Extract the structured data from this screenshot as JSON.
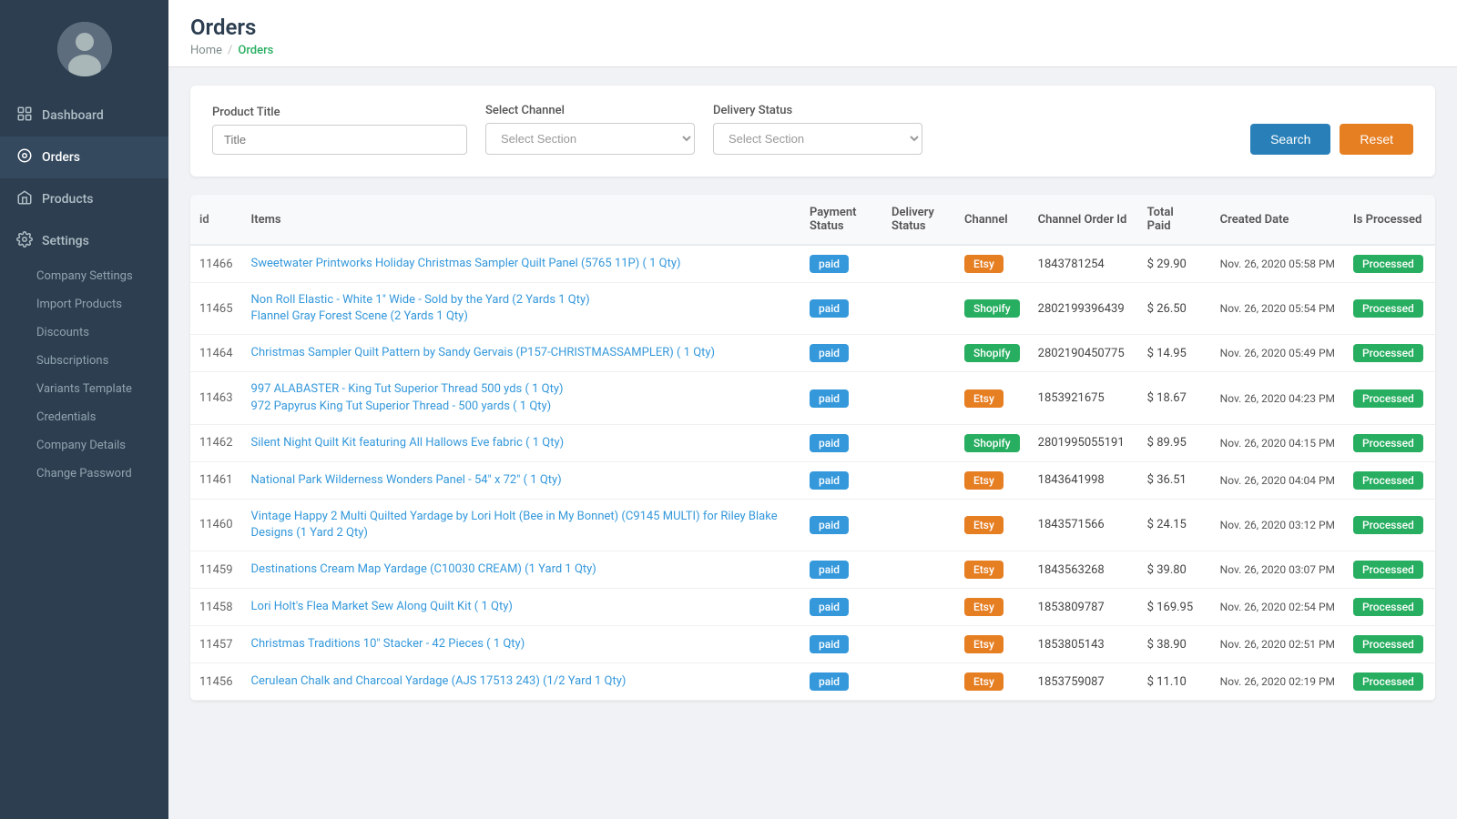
{
  "sidebar": {
    "nav_items": [
      {
        "id": "dashboard",
        "label": "Dashboard",
        "icon": "dashboard-icon",
        "active": false
      },
      {
        "id": "orders",
        "label": "Orders",
        "icon": "orders-icon",
        "active": true
      },
      {
        "id": "products",
        "label": "Products",
        "icon": "products-icon",
        "active": false
      },
      {
        "id": "settings",
        "label": "Settings",
        "icon": "settings-icon",
        "active": false,
        "expanded": true
      }
    ],
    "settings_submenu": [
      {
        "id": "company-settings",
        "label": "Company Settings"
      },
      {
        "id": "import-products",
        "label": "Import Products"
      },
      {
        "id": "discounts",
        "label": "Discounts"
      },
      {
        "id": "subscriptions",
        "label": "Subscriptions"
      },
      {
        "id": "variants-template",
        "label": "Variants Template"
      },
      {
        "id": "credentials",
        "label": "Credentials"
      },
      {
        "id": "company-details",
        "label": "Company Details"
      },
      {
        "id": "change-password",
        "label": "Change Password"
      }
    ]
  },
  "page": {
    "title": "Orders",
    "breadcrumb_home": "Home",
    "breadcrumb_separator": "/",
    "breadcrumb_current": "Orders"
  },
  "filters": {
    "product_title_label": "Product Title",
    "product_title_placeholder": "Title",
    "select_channel_label": "Select Channel",
    "select_channel_placeholder": "Select Section",
    "delivery_status_label": "Delivery Status",
    "delivery_status_placeholder": "Select Section",
    "search_button": "Search",
    "reset_button": "Reset"
  },
  "table": {
    "columns": [
      "id",
      "Items",
      "Payment Status",
      "Delivery Status",
      "Channel",
      "Channel Order Id",
      "Total Paid",
      "Created Date",
      "Is Processed"
    ],
    "rows": [
      {
        "id": "11466",
        "items": [
          "Sweetwater Printworks Holiday Christmas Sampler Quilt Panel (5765 11P) ( 1 Qty)"
        ],
        "payment_status": "paid",
        "delivery_status": "",
        "channel": "Etsy",
        "channel_order_id": "1843781254",
        "total_paid": "$ 29.90",
        "created_date": "Nov. 26, 2020 05:58 PM",
        "is_processed": "Processed"
      },
      {
        "id": "11465",
        "items": [
          "Non Roll Elastic - White 1\" Wide - Sold by the Yard (2 Yards 1 Qty)",
          "Flannel Gray Forest Scene (2 Yards 1 Qty)"
        ],
        "payment_status": "paid",
        "delivery_status": "",
        "channel": "Shopify",
        "channel_order_id": "2802199396439",
        "total_paid": "$ 26.50",
        "created_date": "Nov. 26, 2020 05:54 PM",
        "is_processed": "Processed"
      },
      {
        "id": "11464",
        "items": [
          "Christmas Sampler Quilt Pattern by Sandy Gervais (P157-CHRISTMASSAMPLER) ( 1 Qty)"
        ],
        "payment_status": "paid",
        "delivery_status": "",
        "channel": "Shopify",
        "channel_order_id": "2802190450775",
        "total_paid": "$ 14.95",
        "created_date": "Nov. 26, 2020 05:49 PM",
        "is_processed": "Processed"
      },
      {
        "id": "11463",
        "items": [
          "997 ALABASTER - King Tut Superior Thread 500 yds ( 1 Qty)",
          "972 Papyrus King Tut Superior Thread - 500 yards ( 1 Qty)"
        ],
        "payment_status": "paid",
        "delivery_status": "",
        "channel": "Etsy",
        "channel_order_id": "1853921675",
        "total_paid": "$ 18.67",
        "created_date": "Nov. 26, 2020 04:23 PM",
        "is_processed": "Processed"
      },
      {
        "id": "11462",
        "items": [
          "Silent Night Quilt Kit featuring All Hallows Eve fabric ( 1 Qty)"
        ],
        "payment_status": "paid",
        "delivery_status": "",
        "channel": "Shopify",
        "channel_order_id": "2801995055191",
        "total_paid": "$ 89.95",
        "created_date": "Nov. 26, 2020 04:15 PM",
        "is_processed": "Processed"
      },
      {
        "id": "11461",
        "items": [
          "National Park Wilderness Wonders Panel - 54\" x 72\" ( 1 Qty)"
        ],
        "payment_status": "paid",
        "delivery_status": "",
        "channel": "Etsy",
        "channel_order_id": "1843641998",
        "total_paid": "$ 36.51",
        "created_date": "Nov. 26, 2020 04:04 PM",
        "is_processed": "Processed"
      },
      {
        "id": "11460",
        "items": [
          "Vintage Happy 2 Multi Quilted Yardage by Lori Holt (Bee in My Bonnet) (C9145 MULTI) for Riley Blake Designs (1 Yard 2 Qty)"
        ],
        "payment_status": "paid",
        "delivery_status": "",
        "channel": "Etsy",
        "channel_order_id": "1843571566",
        "total_paid": "$ 24.15",
        "created_date": "Nov. 26, 2020 03:12 PM",
        "is_processed": "Processed"
      },
      {
        "id": "11459",
        "items": [
          "Destinations Cream Map Yardage (C10030 CREAM) (1 Yard 1 Qty)"
        ],
        "payment_status": "paid",
        "delivery_status": "",
        "channel": "Etsy",
        "channel_order_id": "1843563268",
        "total_paid": "$ 39.80",
        "created_date": "Nov. 26, 2020 03:07 PM",
        "is_processed": "Processed"
      },
      {
        "id": "11458",
        "items": [
          "Lori Holt's Flea Market Sew Along Quilt Kit ( 1 Qty)"
        ],
        "payment_status": "paid",
        "delivery_status": "",
        "channel": "Etsy",
        "channel_order_id": "1853809787",
        "total_paid": "$ 169.95",
        "created_date": "Nov. 26, 2020 02:54 PM",
        "is_processed": "Processed"
      },
      {
        "id": "11457",
        "items": [
          "Christmas Traditions 10\" Stacker - 42 Pieces ( 1 Qty)"
        ],
        "payment_status": "paid",
        "delivery_status": "",
        "channel": "Etsy",
        "channel_order_id": "1853805143",
        "total_paid": "$ 38.90",
        "created_date": "Nov. 26, 2020 02:51 PM",
        "is_processed": "Processed"
      },
      {
        "id": "11456",
        "items": [
          "Cerulean Chalk and Charcoal Yardage (AJS 17513 243) (1/2 Yard 1 Qty)"
        ],
        "payment_status": "paid",
        "delivery_status": "",
        "channel": "Etsy",
        "channel_order_id": "1853759087",
        "total_paid": "$ 11.10",
        "created_date": "Nov. 26, 2020 02:19 PM",
        "is_processed": "Processed"
      }
    ]
  }
}
